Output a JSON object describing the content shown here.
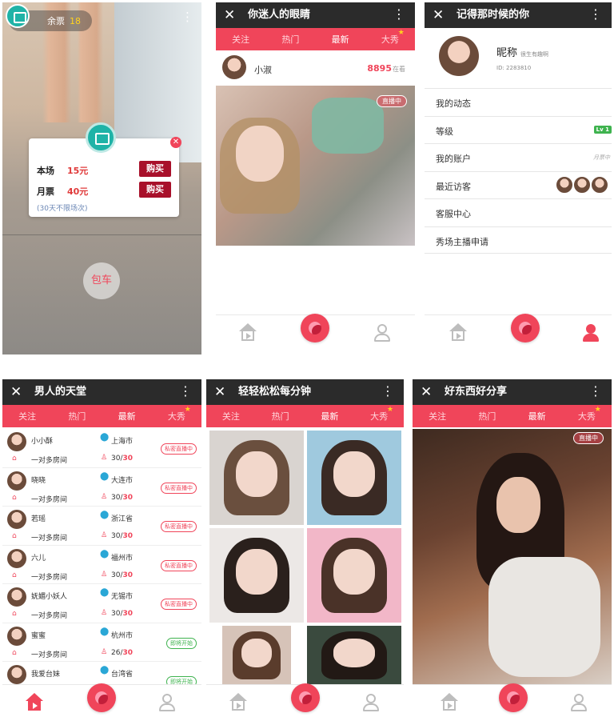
{
  "tabs": [
    {
      "label": "关注",
      "active": false
    },
    {
      "label": "热门",
      "active": false
    },
    {
      "label": "最新",
      "active": true
    },
    {
      "label": "大秀",
      "active": false
    }
  ],
  "screen1": {
    "ticket_label": "余票",
    "ticket_count": "18",
    "dialog": {
      "rows": [
        {
          "label": "本场",
          "price": "15元",
          "button": "购买"
        },
        {
          "label": "月票",
          "price": "40元",
          "button": "购买"
        }
      ],
      "note": "(30天不限场次)"
    },
    "charter_button": "包车"
  },
  "screen2": {
    "title": "你迷人的眼睛",
    "host_name": "小淑",
    "viewers": "8895",
    "viewers_unit": "在看",
    "live_tag": "直播中"
  },
  "screen3": {
    "title": "记得那时候的你",
    "nickname": "昵称",
    "nickname_sub": "很生有趣啊",
    "user_id": "ID: 2283810",
    "menu": [
      {
        "label": "我的动态"
      },
      {
        "label": "等级",
        "badge": "Lv 1"
      },
      {
        "label": "我的账户",
        "hint": "月票中"
      },
      {
        "label": "最近访客"
      },
      {
        "label": "客服中心"
      },
      {
        "label": "秀场主播申请"
      }
    ]
  },
  "screen4": {
    "title": "男人的天堂",
    "rows": [
      {
        "name": "小小酥",
        "city": "上海市",
        "type": "一对多房间",
        "current": "30",
        "capacity": "30",
        "status": "私密直播中",
        "state": "live"
      },
      {
        "name": "晓晓",
        "city": "大连市",
        "type": "一对多房间",
        "current": "30",
        "capacity": "30",
        "status": "私密直播中",
        "state": "live"
      },
      {
        "name": "若瑶",
        "city": "浙江省",
        "type": "一对多房间",
        "current": "30",
        "capacity": "30",
        "status": "私密直播中",
        "state": "live"
      },
      {
        "name": "六儿",
        "city": "福州市",
        "type": "一对多房间",
        "current": "30",
        "capacity": "30",
        "status": "私密直播中",
        "state": "live"
      },
      {
        "name": "妩媚小妖人",
        "city": "无锡市",
        "type": "一对多房间",
        "current": "30",
        "capacity": "30",
        "status": "私密直播中",
        "state": "live"
      },
      {
        "name": "蜜蜜",
        "city": "杭州市",
        "type": "一对多房间",
        "current": "26",
        "capacity": "30",
        "status": "即将开始",
        "state": "soon"
      },
      {
        "name": "我爱台妹",
        "city": "台湾省",
        "type": "",
        "current": "",
        "capacity": "",
        "status": "即将开始",
        "state": "soon"
      }
    ]
  },
  "screen5": {
    "title": "轻轻松松每分钟"
  },
  "screen6": {
    "title": "好东西好分享",
    "live_tag": "直播中"
  },
  "icons": {
    "close": "close-icon",
    "more": "more-icon",
    "home": "home-icon",
    "live": "live-camera-icon",
    "user": "user-icon",
    "location": "location-pin-icon",
    "person": "person-icon",
    "ticket": "ticket-icon"
  },
  "colors": {
    "accent": "#f0455a",
    "titlebar": "#2b2b2b",
    "teal": "#1fb3a7",
    "buy_button": "#a8102a",
    "location": "#2aa7d6",
    "soon": "#3fb34f"
  }
}
